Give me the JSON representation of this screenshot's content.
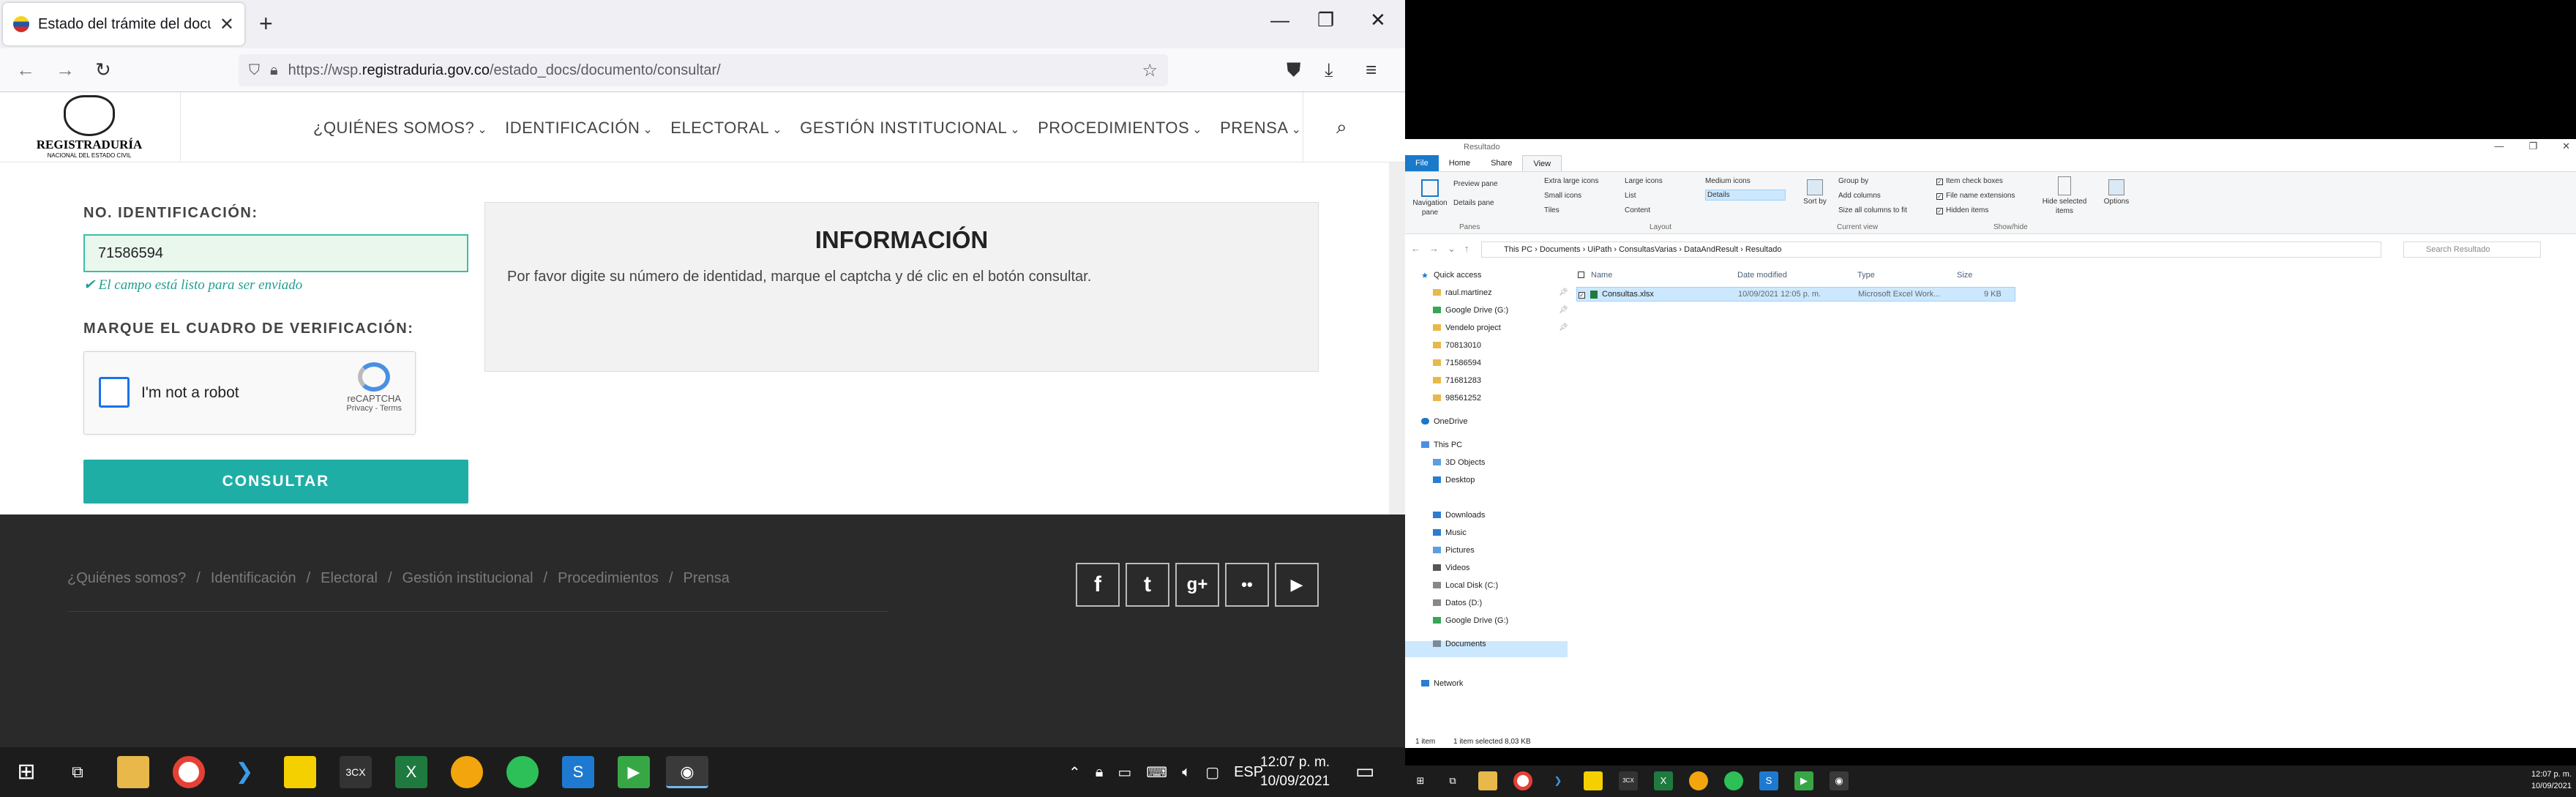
{
  "browser": {
    "tab_title": "Estado del trámite del documen",
    "url_prefix": "https://wsp.",
    "url_domain": "registraduria.gov.co",
    "url_path": "/estado_docs/documento/consultar/"
  },
  "site": {
    "logo_name": "REGISTRADURÍA",
    "logo_sub": "NACIONAL DEL ESTADO CIVIL",
    "menu": [
      "¿QUIÉNES SOMOS?",
      "IDENTIFICACIÓN",
      "ELECTORAL",
      "GESTIÓN INSTITUCIONAL",
      "PROCEDIMIENTOS",
      "PRENSA"
    ]
  },
  "form": {
    "id_label": "NO. IDENTIFICACIÓN:",
    "id_value": "71586594",
    "valid_msg": "✔ El campo está listo para ser enviado",
    "captcha_label": "MARQUE EL CUADRO DE VERIFICACIÓN:",
    "captcha_text": "I'm not a robot",
    "captcha_brand": "reCAPTCHA",
    "captcha_links": "Privacy - Terms",
    "submit_label": "CONSULTAR"
  },
  "info": {
    "title": "INFORMACIÓN",
    "text": "Por favor digite su número de identidad, marque el captcha y dé clic en el botón consultar."
  },
  "footer": {
    "links": [
      "¿Quiénes somos?",
      "/",
      "Identificación",
      "/",
      "Electoral",
      "/",
      "Gestión institucional",
      "/",
      "Procedimientos",
      "/",
      "Prensa"
    ],
    "social": [
      "f",
      "t",
      "g+",
      "••",
      "▶"
    ]
  },
  "taskbar": {
    "lang": "ESP",
    "time": "12:07 p. m.",
    "date": "10/09/2021"
  },
  "explorer": {
    "title": "Resultado",
    "ribbon_tabs": [
      "File",
      "Home",
      "Share",
      "View"
    ],
    "panes": {
      "nav": "Navigation pane",
      "preview": "Preview pane",
      "details": "Details pane",
      "caption": "Panes"
    },
    "layout": {
      "items": [
        "Extra large icons",
        "Large icons",
        "Medium icons",
        "Small icons",
        "List",
        "Details",
        "Tiles",
        "Content"
      ],
      "caption": "Layout"
    },
    "current_view": {
      "sort": "Sort by",
      "group": "Group by",
      "add_cols": "Add columns",
      "size_cols": "Size all columns to fit",
      "caption": "Current view"
    },
    "show_hide": {
      "item_check": "Item check boxes",
      "ext": "File name extensions",
      "hidden": "Hidden items",
      "hide_sel": "Hide selected items",
      "caption": "Show/hide"
    },
    "options": "Options",
    "breadcrumb": "This PC  ›  Documents  ›  UiPath  ›  ConsultasVarias  ›  DataAndResult  ›  Resultado",
    "search_placeholder": "Search Resultado",
    "nav": [
      "Quick access",
      "raul.martinez",
      "Google Drive (G:)",
      "Vendelo project",
      "70813010",
      "71586594",
      "71681283",
      "98561252",
      "OneDrive",
      "This PC",
      "3D Objects",
      "Desktop",
      "Documents",
      "Downloads",
      "Music",
      "Pictures",
      "Videos",
      "Local Disk (C:)",
      "Datos (D:)",
      "Google Drive (G:)",
      "Network"
    ],
    "columns": [
      "Name",
      "Date modified",
      "Type",
      "Size"
    ],
    "file": {
      "name": "Consultas.xlsx",
      "date": "10/09/2021 12:05 p. m.",
      "type": "Microsoft Excel Work...",
      "size": "9 KB"
    },
    "status": {
      "count": "1 item",
      "selected": "1 item selected  8,03 KB"
    }
  },
  "taskbar2": {
    "time": "12:07 p. m.",
    "date": "10/09/2021"
  }
}
